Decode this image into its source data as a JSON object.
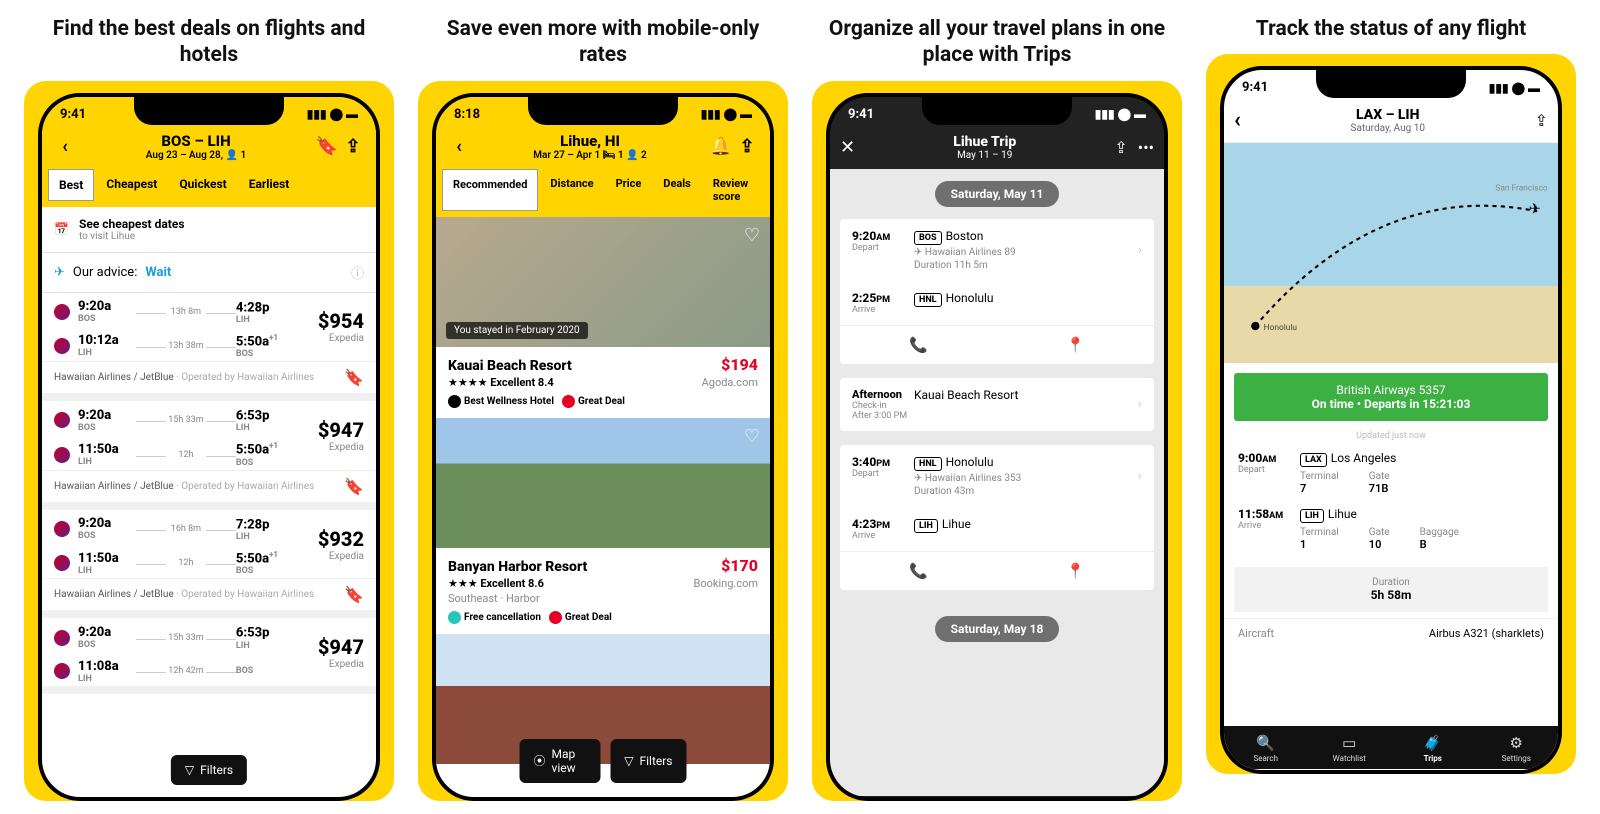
{
  "panels": [
    {
      "caption": "Find the best deals on flights and hotels"
    },
    {
      "caption": "Save even more with mobile-only rates"
    },
    {
      "caption": "Organize all your travel plans in one place with Trips"
    },
    {
      "caption": "Track the status of any flight"
    }
  ],
  "p1": {
    "status_time": "9:41",
    "title": "BOS – LIH",
    "sub": "Aug 23 – Aug 28,  👤 1",
    "tabs": [
      "Best",
      "Cheapest",
      "Quickest",
      "Earliest"
    ],
    "cheapest": {
      "title": "See cheapest dates",
      "sub": "to visit Lihue"
    },
    "advice_prefix": "Our advice: ",
    "advice_action": "Wait",
    "flights": [
      {
        "segs": [
          {
            "dep": "9:20a",
            "depcode": "BOS",
            "dur": "13h 8m",
            "arr": "4:28p",
            "arrcode": "LIH",
            "plus": ""
          },
          {
            "dep": "10:12a",
            "depcode": "LIH",
            "dur": "13h 38m",
            "arr": "5:50a",
            "arrcode": "BOS",
            "plus": "+1"
          }
        ],
        "price": "$954",
        "src": "Expedia",
        "ops_main": "Hawaiian Airlines / JetBlue",
        "ops_sub": " · Operated by Hawaiian Airlines"
      },
      {
        "segs": [
          {
            "dep": "9:20a",
            "depcode": "BOS",
            "dur": "15h 33m",
            "arr": "6:53p",
            "arrcode": "LIH",
            "plus": ""
          },
          {
            "dep": "11:50a",
            "depcode": "LIH",
            "dur": "12h",
            "arr": "5:50a",
            "arrcode": "BOS",
            "plus": "+1"
          }
        ],
        "price": "$947",
        "src": "Expedia",
        "ops_main": "Hawaiian Airlines / JetBlue",
        "ops_sub": " · Operated by Hawaiian Airlines"
      },
      {
        "segs": [
          {
            "dep": "9:20a",
            "depcode": "BOS",
            "dur": "16h 8m",
            "arr": "7:28p",
            "arrcode": "LIH",
            "plus": ""
          },
          {
            "dep": "11:50a",
            "depcode": "LIH",
            "dur": "12h",
            "arr": "5:50a",
            "arrcode": "BOS",
            "plus": "+1"
          }
        ],
        "price": "$932",
        "src": "Expedia",
        "ops_main": "Hawaiian Airlines / JetBlue",
        "ops_sub": " · Operated by Hawaiian Airlines"
      },
      {
        "segs": [
          {
            "dep": "9:20a",
            "depcode": "BOS",
            "dur": "15h 33m",
            "arr": "6:53p",
            "arrcode": "LIH",
            "plus": ""
          },
          {
            "dep": "11:08a",
            "depcode": "LIH",
            "dur": "12h 42m",
            "arr": "",
            "arrcode": "BOS",
            "plus": ""
          }
        ],
        "price": "$947",
        "src": "Expedia",
        "ops_main": "",
        "ops_sub": ""
      }
    ],
    "filters_label": "Filters"
  },
  "p2": {
    "status_time": "8:18",
    "title": "Lihue, HI",
    "sub": "Mar 27 – Apr 1  🛏 1  👤 2",
    "tabs": [
      "Recommended",
      "Distance",
      "Price",
      "Deals",
      "Review score"
    ],
    "hotels": [
      {
        "stayed": "You stayed in February 2020",
        "name": "Kauai Beach Resort",
        "stars": "★★★★",
        "rating": "Excellent 8.4",
        "price": "$194",
        "src": "Agoda.com",
        "badge1": "Best Wellness Hotel",
        "badge2": "Great Deal"
      },
      {
        "name": "Banyan Harbor Resort",
        "stars": "★★★",
        "rating": "Excellent 8.6",
        "loc": "Southeast · Harbor",
        "price": "$170",
        "src": "Booking.com",
        "badge1": "Free cancellation",
        "badge2": "Great Deal"
      }
    ],
    "map_label": "Map view",
    "filters_label": "Filters"
  },
  "p3": {
    "status_time": "9:41",
    "title": "Lihue Trip",
    "sub": "May 11 – 19",
    "date1": "Saturday, May 11",
    "card1": {
      "r1": {
        "time": "9:20",
        "ampm": "AM",
        "lbl": "Depart",
        "code": "BOS",
        "city": "Boston",
        "airline": "Hawaiian Airlines 89",
        "dur": "Duration 11h 5m"
      },
      "r2": {
        "time": "2:25",
        "ampm": "PM",
        "lbl": "Arrive",
        "code": "HNL",
        "city": "Honolulu"
      }
    },
    "card2": {
      "time": "Afternoon",
      "lbl": "Check-in",
      "lbl2": "After 3:00 PM",
      "name": "Kauai Beach Resort"
    },
    "card3": {
      "r1": {
        "time": "3:40",
        "ampm": "PM",
        "lbl": "Depart",
        "code": "HNL",
        "city": "Honolulu",
        "airline": "Hawaiian Airlines 353",
        "dur": "Duration 43m"
      },
      "r2": {
        "time": "4:23",
        "ampm": "PM",
        "lbl": "Arrive",
        "code": "LIH",
        "city": "Lihue"
      }
    },
    "date2": "Saturday, May 18"
  },
  "p4": {
    "status_time": "9:41",
    "title": "LAX – LIH",
    "sub": "Saturday, Aug 10",
    "map_label_sf": "San Francisco",
    "map_label_hnl": "Honolulu",
    "banner_line1": "British Airways 5357",
    "banner_line2": "On time • Departs in 15:21:03",
    "updated": "Updated just now",
    "r1": {
      "time": "9:00",
      "ampm": "AM",
      "lbl": "Depart",
      "code": "LAX",
      "city": "Los Angeles",
      "term_l": "Terminal",
      "term_v": "7",
      "gate_l": "Gate",
      "gate_v": "71B"
    },
    "r2": {
      "time": "11:58",
      "ampm": "AM",
      "lbl": "Arrive",
      "code": "LIH",
      "city": "Lihue",
      "term_l": "Terminal",
      "term_v": "1",
      "gate_l": "Gate",
      "gate_v": "10",
      "bag_l": "Baggage",
      "bag_v": "B"
    },
    "dur_l": "Duration",
    "dur_v": "5h 58m",
    "aircraft_l": "Aircraft",
    "aircraft_v": "Airbus A321 (sharklets)",
    "nav": [
      "Search",
      "Watchlist",
      "Trips",
      "Settings"
    ]
  }
}
